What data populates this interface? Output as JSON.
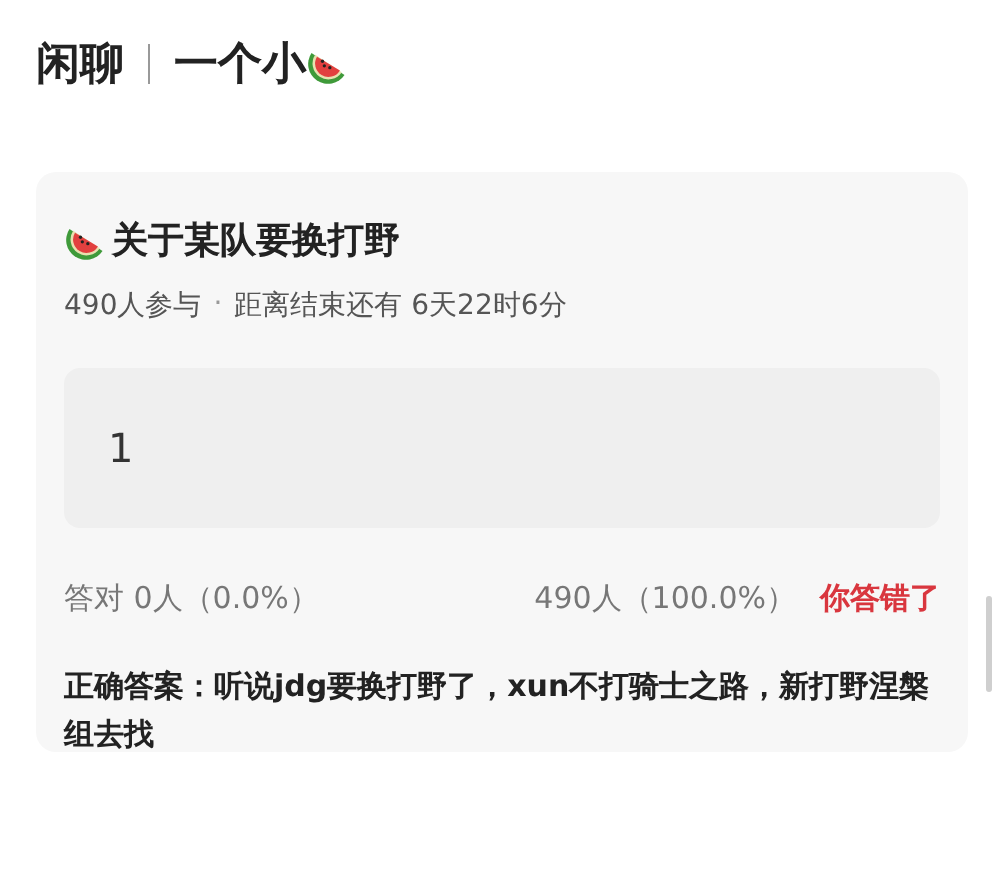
{
  "header": {
    "channel": "闲聊",
    "title": "一个小"
  },
  "question": {
    "title": "关于某队要换打野",
    "participants": "490人参与",
    "separator": "·",
    "deadline": "距离结束还有 6天22时6分",
    "answer": "1",
    "correct_stat": "答对 0人（0.0%）",
    "wrong_stat": "490人（100.0%）",
    "result": {
      "text": "你答错了",
      "correct": false
    },
    "solution": "正确答案：听说jdg要换打野了，xun不打骑士之路，新打野涅槃组去找"
  }
}
